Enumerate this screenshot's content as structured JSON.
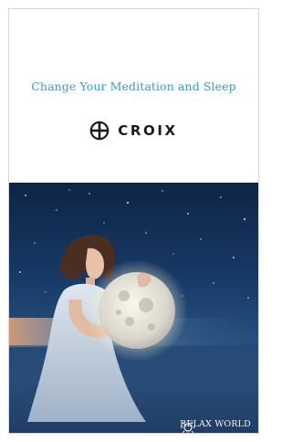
{
  "ad": {
    "headline": "Change Your Meditation and Sleep",
    "brand_name": "CROIX",
    "brand_logo_icon": "cross-in-circle-icon",
    "watermark_text": "RELAX WORLD",
    "watermark_logo_icon": "sun-logo-icon",
    "colors": {
      "headline": "#3b97c6",
      "brand": "#1a1a1a",
      "night_sky": "#183a66"
    }
  }
}
